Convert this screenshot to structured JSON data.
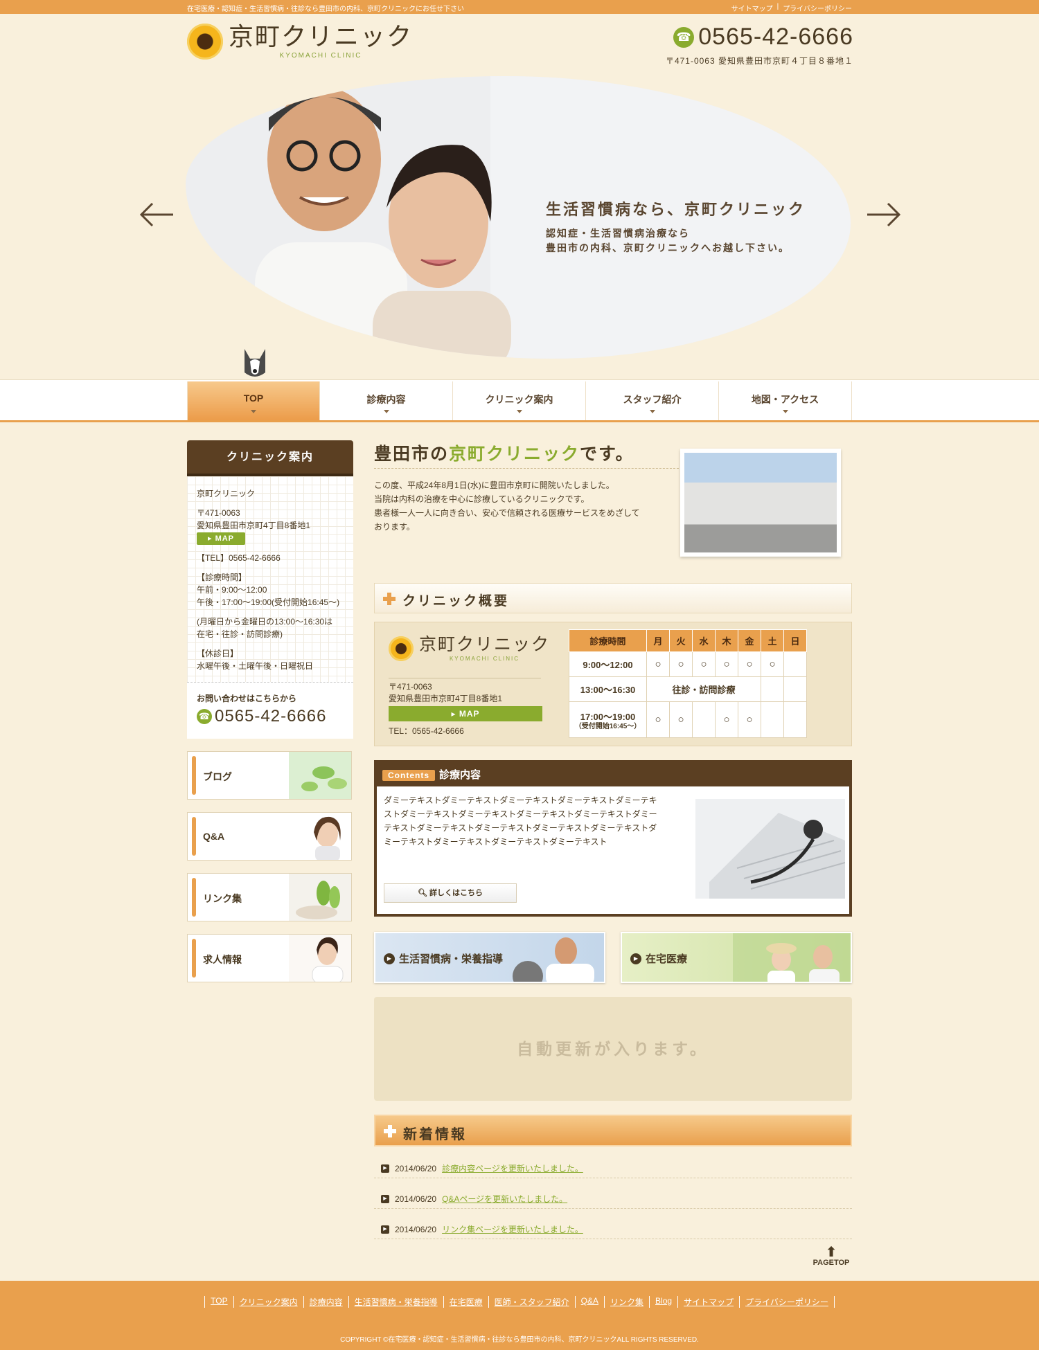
{
  "topbar": {
    "tagline": "在宅医療・認知症・生活習慣病・往診なら豊田市の内科、京町クリニックにお任せ下さい",
    "links": [
      "サイトマップ",
      "|",
      "プライバシーポリシー"
    ]
  },
  "header": {
    "logo_jp": "京町クリニック",
    "logo_en": "KYOMACHI CLINIC",
    "tel": "0565-42-6666",
    "address": "〒471-0063 愛知県豊田市京町４丁目８番地１"
  },
  "hero": {
    "title": "生活習慣病なら、京町クリニック",
    "sub1": "認知症・生活習慣病治療なら",
    "sub2": "豊田市の内科、京町クリニックへお越し下さい。"
  },
  "nav": {
    "items": [
      "TOP",
      "診療内容",
      "クリニック案内",
      "スタッフ紹介",
      "地図・アクセス"
    ]
  },
  "sidebar": {
    "heading": "クリニック案内",
    "name": "京町クリニック",
    "postal": "〒471-0063",
    "address": "愛知県豊田市京町4丁目8番地1",
    "map_label": "MAP",
    "tel_line": "【TEL】0565-42-6666",
    "hours_head": "【診療時間】",
    "hours_am": "午前・9:00〜12:00",
    "hours_pm": "午後・17:00〜19:00(受付開始16:45〜)",
    "note1": "(月曜日から金曜日の13:00〜16:30は",
    "note2": "在宅・往診・訪問診療)",
    "closed_head": "【休診日】",
    "closed": "水曜午後・土曜午後・日曜祝日",
    "contact_label": "お問い合わせはこちらから",
    "contact_tel": "0565-42-6666",
    "banners": [
      "ブログ",
      "Q&A",
      "リンク集",
      "求人情報"
    ]
  },
  "intro": {
    "title_pre": "豊田市の",
    "title_hl": "京町クリニック",
    "title_post": "です。",
    "lines": [
      "この度、平成24年8月1日(水)に豊田市京町に開院いたしました。",
      "当院は内科の治療を中心に診療しているクリニックです。",
      "患者様一人一人に向き合い、安心で信頼される医療サービスをめざして",
      "おります。"
    ]
  },
  "overview": {
    "heading": "クリニック概要",
    "logo_jp": "京町クリニック",
    "logo_en": "KYOMACHI CLINIC",
    "postal": "〒471-0063",
    "address": "愛知県豊田市京町4丁目8番地1",
    "map_label": "MAP",
    "tel": "TEL：0565-42-6666",
    "table": {
      "header": [
        "診療時間",
        "月",
        "火",
        "水",
        "木",
        "金",
        "土",
        "日"
      ],
      "row1_time": "9:00〜12:00",
      "row1": [
        "○",
        "○",
        "○",
        "○",
        "○",
        "○",
        ""
      ],
      "row2_time": "13:00〜16:30",
      "row2_note": "往診・訪問診療",
      "row3_time": "17:00〜19:00",
      "row3_sub": "（受付開始16:45〜）",
      "row3": [
        "○",
        "○",
        "",
        "○",
        "○",
        "",
        ""
      ]
    }
  },
  "contents": {
    "badge": "Contents",
    "title": "診療内容",
    "body": "ダミーテキストダミーテキストダミーテキストダミーテキストダミーテキストダミーテキストダミーテキストダミーテキストダミーテキストダミーテキストダミーテキストダミーテキストダミーテキストダミーテキストダミーテキストダミーテキストダミーテキストダミーテキスト",
    "more": "詳しくはこちら"
  },
  "banners": {
    "left": "生活習慣病・栄養指導",
    "right": "在宅医療"
  },
  "auto_update": "自動更新が入ります。",
  "news": {
    "heading": "新着情報",
    "items": [
      {
        "date": "2014/06/20",
        "text": "診療内容ページを更新いたしました。"
      },
      {
        "date": "2014/06/20",
        "text": "Q&Aページを更新いたしました。"
      },
      {
        "date": "2014/06/20",
        "text": "リンク集ページを更新いたしました。"
      }
    ]
  },
  "pagetop": "PAGETOP",
  "footer": {
    "links": [
      "TOP",
      "クリニック案内",
      "診療内容",
      "生活習慣病・栄養指導",
      "在宅医療",
      "医師・スタッフ紹介",
      "Q&A",
      "リンク集",
      "Blog",
      "サイトマップ",
      "プライバシーポリシー"
    ],
    "copyright": "COPYRIGHT ©在宅医療・認知症・生活習慣病・往診なら豊田市の内科、京町クリニックALL RIGHTS RESERVED."
  },
  "colors": {
    "accent": "#e9a04d",
    "brand_green": "#8aab2e",
    "dark_brown": "#5b3f22",
    "background": "#f9f0dc"
  }
}
